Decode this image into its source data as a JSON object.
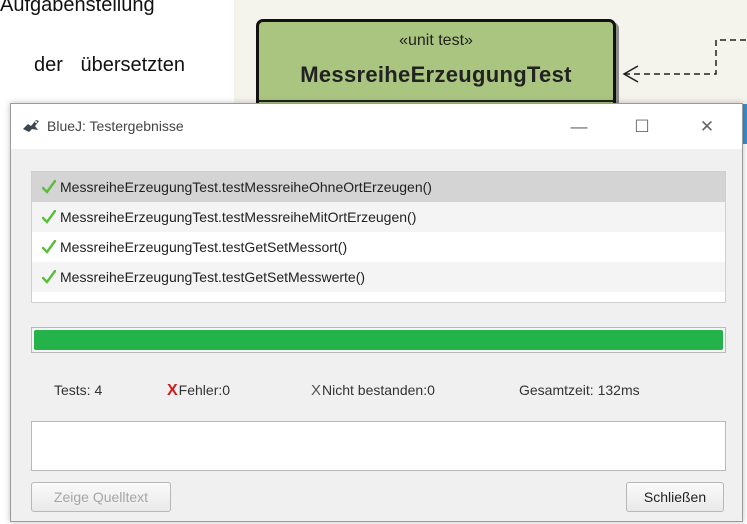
{
  "background": {
    "doc_line1": "Aufgabenstellung",
    "doc_line2": "der übersetzten",
    "uml_stereotype": "«unit test»",
    "uml_class_name": "MessreiheErzeugungTest"
  },
  "window": {
    "title": "BlueJ:  Testergebnisse",
    "controls": {
      "minimize": "—",
      "maximize": "☐",
      "close": "✕"
    }
  },
  "tests": [
    {
      "name": "MessreiheErzeugungTest.testMessreiheOhneOrtErzeugen()",
      "status": "passed",
      "selected": true
    },
    {
      "name": "MessreiheErzeugungTest.testMessreiheMitOrtErzeugen()",
      "status": "passed",
      "selected": false
    },
    {
      "name": "MessreiheErzeugungTest.testGetSetMessort()",
      "status": "passed",
      "selected": false
    },
    {
      "name": "MessreiheErzeugungTest.testGetSetMesswerte()",
      "status": "passed",
      "selected": false
    }
  ],
  "progress": {
    "fraction": 1.0,
    "color": "#24b24a"
  },
  "stats": {
    "tests": "Tests:  4",
    "errors_label": "Fehler:0",
    "failures_label": "Nicht bestanden:0",
    "total_time": "Gesamtzeit:  132ms",
    "error_marker": "X",
    "failure_marker": "X"
  },
  "message": "",
  "buttons": {
    "show_source": "Zeige Quelltext",
    "close": "Schließen"
  },
  "colors": {
    "pass_check": "#5cbd3c",
    "error_x": "#d21a1a",
    "uml_fill": "#a9c57f"
  }
}
